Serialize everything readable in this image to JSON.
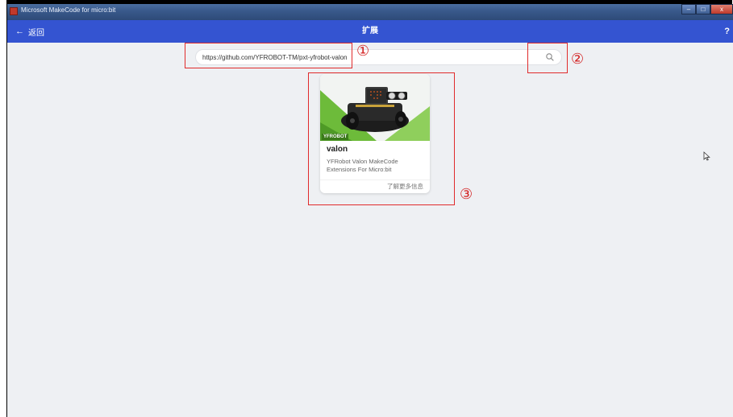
{
  "window": {
    "title": "Microsoft MakeCode for micro:bit",
    "minimize_glyph": "–",
    "maximize_glyph": "□",
    "close_glyph": "x"
  },
  "header": {
    "back_label": "返回",
    "back_icon": "←",
    "title": "扩展",
    "help_label": "?"
  },
  "search": {
    "value": "https://github.com/YFROBOT-TM/pxt-yfrobot-valon",
    "placeholder": "",
    "icon": "search-icon"
  },
  "results": [
    {
      "title": "valon",
      "description": "YFRobot Valon MakeCode Extensions For Micro:bit",
      "more_label": "了解更多信息",
      "image_badge": "YFROBOT"
    }
  ],
  "annotations": {
    "one": "①",
    "two": "②",
    "three": "③"
  },
  "colors": {
    "header": "#3454d1",
    "background": "#eef0f3",
    "annotation": "#e02b2b"
  }
}
